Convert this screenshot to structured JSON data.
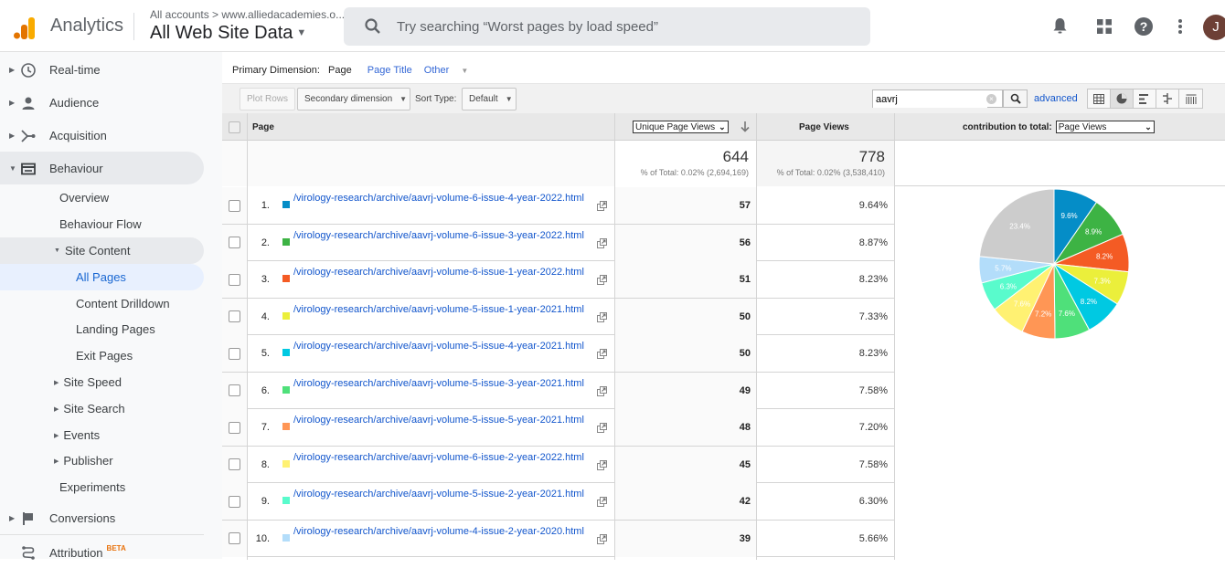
{
  "app": {
    "name": "Analytics",
    "breadcrumb": "All accounts > www.alliedacademies.o...",
    "property": "All Web Site Data",
    "search_placeholder": "Try searching “Worst pages by load speed”",
    "avatar_initial": "J",
    "top_icons": [
      "bell-icon",
      "apps-grid-icon",
      "help-icon",
      "more-vert-icon"
    ]
  },
  "sidebar": {
    "top_items": [
      {
        "label": "Real-time",
        "icon": "clock-icon"
      },
      {
        "label": "Audience",
        "icon": "person-icon"
      },
      {
        "label": "Acquisition",
        "icon": "acquisition-icon"
      },
      {
        "label": "Behaviour",
        "icon": "behaviour-icon"
      }
    ],
    "behaviour_items": [
      {
        "label": "Overview"
      },
      {
        "label": "Behaviour Flow"
      },
      {
        "label": "Site Content"
      },
      {
        "label": "All Pages"
      },
      {
        "label": "Content Drilldown"
      },
      {
        "label": "Landing Pages"
      },
      {
        "label": "Exit Pages"
      },
      {
        "label": "Site Speed"
      },
      {
        "label": "Site Search"
      },
      {
        "label": "Events"
      },
      {
        "label": "Publisher"
      },
      {
        "label": "Experiments"
      }
    ],
    "bottom_items": [
      {
        "label": "Conversions",
        "icon": "flag-icon"
      },
      {
        "label": "Attribution",
        "icon": "attribution-icon",
        "badge": "BETA"
      }
    ]
  },
  "report": {
    "primary_dimension_label": "Primary Dimension:",
    "primary_dimension_current": "Page",
    "primary_dimension_options": [
      "Page Title",
      "Other"
    ],
    "toolbar": {
      "plot_rows": "Plot Rows",
      "secondary_dimension": "Secondary dimension",
      "sort_type_label": "Sort Type:",
      "sort_type_value": "Default",
      "filter_value": "aavrj",
      "advanced": "advanced"
    },
    "headers": {
      "page": "Page",
      "metric1_select": "Unique Page Views",
      "metric2": "Page Views",
      "contribution_label": "contribution to total:",
      "contribution_select": "Page Views"
    },
    "totals": {
      "unique_page_views": "644",
      "unique_page_views_sub": "% of Total: 0.02% (2,694,169)",
      "page_views": "778",
      "page_views_sub": "% of Total: 0.02% (3,538,410)"
    },
    "rows": [
      {
        "idx": "1.",
        "page": "/virology-research/archive/aavrj-volume-6-issue-4-year-2022.html",
        "unique": "57",
        "pct": "9.64%",
        "color": "#058dc7"
      },
      {
        "idx": "2.",
        "page": "/virology-research/archive/aavrj-volume-6-issue-3-year-2022.html",
        "unique": "56",
        "pct": "8.87%",
        "color": "#3db344"
      },
      {
        "idx": "3.",
        "page": "/virology-research/archive/aavrj-volume-6-issue-1-year-2022.html",
        "unique": "51",
        "pct": "8.23%",
        "color": "#f45b24"
      },
      {
        "idx": "4.",
        "page": "/virology-research/archive/aavrj-volume-5-issue-1-year-2021.html",
        "unique": "50",
        "pct": "7.33%",
        "color": "#ebef3b"
      },
      {
        "idx": "5.",
        "page": "/virology-research/archive/aavrj-volume-5-issue-4-year-2021.html",
        "unique": "50",
        "pct": "8.23%",
        "color": "#00c9e2"
      },
      {
        "idx": "6.",
        "page": "/virology-research/archive/aavrj-volume-5-issue-3-year-2021.html",
        "unique": "49",
        "pct": "7.58%",
        "color": "#4fe07a"
      },
      {
        "idx": "7.",
        "page": "/virology-research/archive/aavrj-volume-5-issue-5-year-2021.html",
        "unique": "48",
        "pct": "7.20%",
        "color": "#ff9655"
      },
      {
        "idx": "8.",
        "page": "/virology-research/archive/aavrj-volume-6-issue-2-year-2022.html",
        "unique": "45",
        "pct": "7.58%",
        "color": "#fff172"
      },
      {
        "idx": "9.",
        "page": "/virology-research/archive/aavrj-volume-5-issue-2-year-2021.html",
        "unique": "42",
        "pct": "6.30%",
        "color": "#59fbcc"
      },
      {
        "idx": "10.",
        "page": "/virology-research/archive/aavrj-volume-4-issue-2-year-2020.html",
        "unique": "39",
        "pct": "5.66%",
        "color": "#b3ddfa"
      }
    ]
  },
  "chart_data": {
    "type": "pie",
    "title": "contribution to total: Page Views",
    "categories": [
      "aavrj-volume-6-issue-4-year-2022",
      "aavrj-volume-6-issue-3-year-2022",
      "aavrj-volume-6-issue-1-year-2022",
      "aavrj-volume-5-issue-1-year-2021",
      "aavrj-volume-5-issue-4-year-2021",
      "aavrj-volume-5-issue-3-year-2021",
      "aavrj-volume-5-issue-5-year-2021",
      "aavrj-volume-6-issue-2-year-2022",
      "aavrj-volume-5-issue-2-year-2021",
      "aavrj-volume-4-issue-2-year-2020",
      "Other"
    ],
    "values": [
      9.6,
      8.9,
      8.2,
      7.3,
      8.2,
      7.6,
      7.2,
      7.6,
      6.3,
      5.7,
      23.4
    ],
    "labels": [
      "9.6%",
      "8.9%",
      "8.2%",
      "7.3%",
      "8.2%",
      "7.6%",
      "7.2%",
      "7.6%",
      "6.3%",
      "5.7%",
      "23.4%"
    ],
    "colors": [
      "#058dc7",
      "#3db344",
      "#f45b24",
      "#ebef3b",
      "#00c9e2",
      "#4fe07a",
      "#ff9655",
      "#fff172",
      "#59fbcc",
      "#b3ddfa",
      "#cccccc"
    ]
  }
}
